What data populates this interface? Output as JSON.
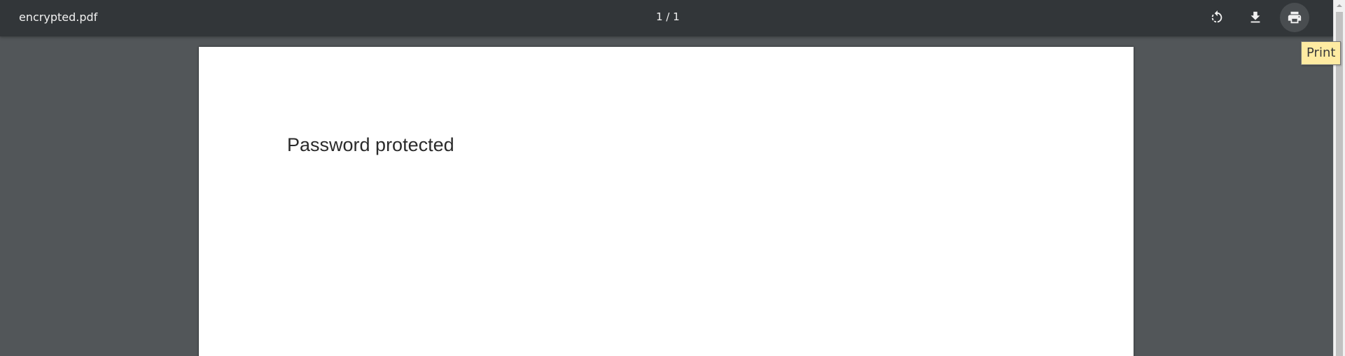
{
  "toolbar": {
    "title": "encrypted.pdf",
    "page_indicator": "1 / 1",
    "buttons": {
      "rotate": {
        "icon": "rotate-icon"
      },
      "download": {
        "icon": "download-icon"
      },
      "print": {
        "icon": "print-icon",
        "tooltip": "Print"
      }
    }
  },
  "page": {
    "text": "Password protected"
  },
  "colors": {
    "toolbar_bg": "#323639",
    "viewer_bg": "#525659",
    "tooltip_bg": "#ffeba2"
  }
}
